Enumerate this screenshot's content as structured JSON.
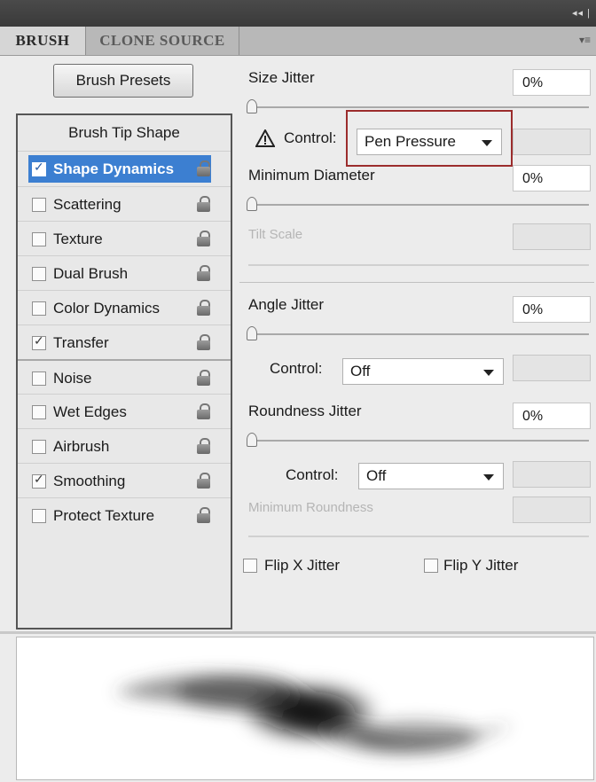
{
  "window": {
    "collapse_glyph": "◂◂ |"
  },
  "tabs": [
    {
      "label": "BRUSH"
    },
    {
      "label": "CLONE SOURCE"
    }
  ],
  "panel_menu_icon": "▾≡",
  "brush_presets_label": "Brush Presets",
  "left_panel": {
    "header": "Brush Tip Shape",
    "items": [
      {
        "label": "Shape Dynamics",
        "checked": true,
        "selected": true
      },
      {
        "label": "Scattering",
        "checked": false
      },
      {
        "label": "Texture",
        "checked": false
      },
      {
        "label": "Dual Brush",
        "checked": false
      },
      {
        "label": "Color Dynamics",
        "checked": false
      },
      {
        "label": "Transfer",
        "checked": true
      },
      {
        "label": "Noise",
        "checked": false
      },
      {
        "label": "Wet Edges",
        "checked": false
      },
      {
        "label": "Airbrush",
        "checked": false
      },
      {
        "label": "Smoothing",
        "checked": true
      },
      {
        "label": "Protect Texture",
        "checked": false
      }
    ]
  },
  "size_jitter": {
    "label": "Size Jitter",
    "value": "0%",
    "control_label": "Control:",
    "control_value": "Pen Pressure"
  },
  "minimum_diameter": {
    "label": "Minimum Diameter",
    "value": "0%"
  },
  "tilt_scale": {
    "label": "Tilt Scale"
  },
  "angle_jitter": {
    "label": "Angle Jitter",
    "value": "0%",
    "control_label": "Control:",
    "control_value": "Off"
  },
  "roundness_jitter": {
    "label": "Roundness Jitter",
    "value": "0%",
    "control_label": "Control:",
    "control_value": "Off"
  },
  "minimum_roundness": {
    "label": "Minimum Roundness"
  },
  "flip_x": {
    "label": "Flip X Jitter",
    "checked": false
  },
  "flip_y": {
    "label": "Flip Y Jitter",
    "checked": false
  },
  "colors": {
    "selection": "#3c7fd1",
    "highlight_border": "#9b2c2c"
  }
}
